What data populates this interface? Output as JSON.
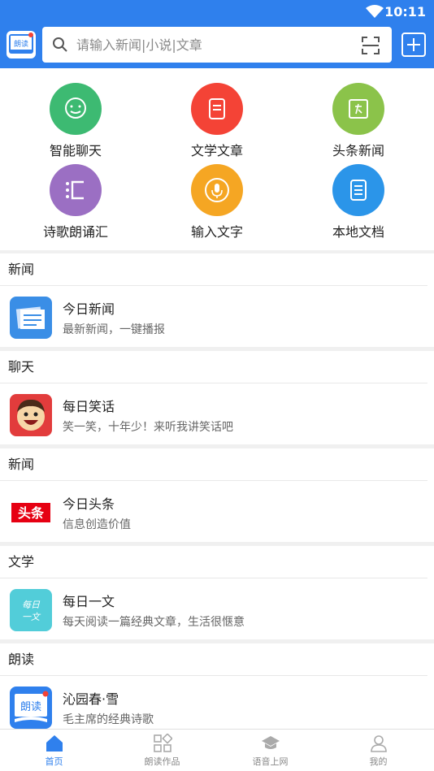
{
  "status_bar": {
    "time": "10:11"
  },
  "header": {
    "search_placeholder": "请输入新闻|小说|文章",
    "logo_text": "朗读"
  },
  "grid": [
    {
      "label": "智能聊天",
      "color": "#3dba72",
      "icon": "chat-bubble-icon"
    },
    {
      "label": "文学文章",
      "color": "#f44336",
      "icon": "document-icon"
    },
    {
      "label": "头条新闻",
      "color": "#8bc34a",
      "icon": "headline-icon"
    },
    {
      "label": "诗歌朗诵汇",
      "color": "#9b6fc3",
      "icon": "poem-icon"
    },
    {
      "label": "输入文字",
      "color": "#f5a623",
      "icon": "microphone-icon"
    },
    {
      "label": "本地文档",
      "color": "#2b95e9",
      "icon": "local-document-icon"
    }
  ],
  "sections": [
    {
      "category": "新闻",
      "title": "今日新闻",
      "subtitle": "最新新闻，一键播报"
    },
    {
      "category": "聊天",
      "title": "每日笑话",
      "subtitle": "笑一笑，十年少！来听我讲笑话吧"
    },
    {
      "category": "新闻",
      "title": "今日头条",
      "subtitle": "信息创造价值",
      "thumb_text": "头条"
    },
    {
      "category": "文学",
      "title": "每日一文",
      "subtitle": "每天阅读一篇经典文章，生活很惬意",
      "thumb_text": "每日一文"
    },
    {
      "category": "朗读",
      "title": "沁园春·雪",
      "subtitle": "毛主席的经典诗歌",
      "thumb_text": "朗读"
    }
  ],
  "tabs": [
    {
      "label": "首页",
      "active": true,
      "icon": "home-icon"
    },
    {
      "label": "朗读作品",
      "active": false,
      "icon": "works-grid-icon"
    },
    {
      "label": "语音上网",
      "active": false,
      "icon": "graduation-cap-icon"
    },
    {
      "label": "我的",
      "active": false,
      "icon": "profile-icon"
    }
  ],
  "colors": {
    "primary": "#2f80ed"
  }
}
